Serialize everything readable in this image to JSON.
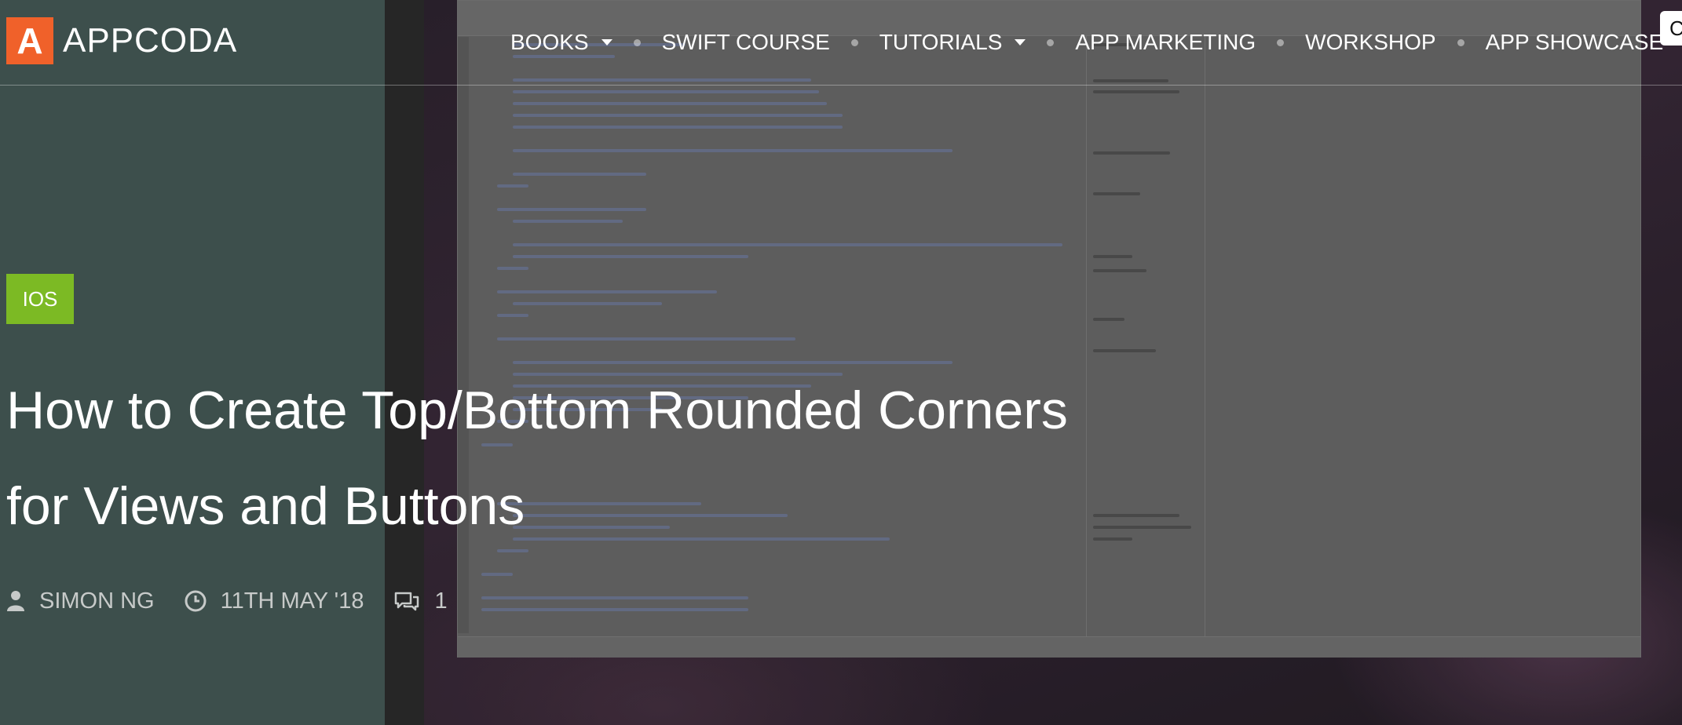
{
  "site": {
    "logo_mark": "A",
    "logo_text": "APPCODA",
    "accent_color": "#f0612a"
  },
  "nav": {
    "items": [
      {
        "label": "BOOKS",
        "has_dropdown": true
      },
      {
        "label": "SWIFT COURSE",
        "has_dropdown": false
      },
      {
        "label": "TUTORIALS",
        "has_dropdown": true
      },
      {
        "label": "APP MARKETING",
        "has_dropdown": false
      },
      {
        "label": "WORKSHOP",
        "has_dropdown": false
      },
      {
        "label": "APP SHOWCASE",
        "has_dropdown": false
      }
    ],
    "search_partial": "C"
  },
  "post": {
    "category": "IOS",
    "category_color": "#7cba24",
    "title_line1": "How to Create Top/Bottom Rounded Corners",
    "title_line2": "for Views and Buttons",
    "author": "SIMON NG",
    "date": "11TH MAY '18",
    "comments": "1"
  },
  "icons": {
    "author": "user-icon",
    "date": "clock-icon",
    "comments": "comments-icon"
  }
}
